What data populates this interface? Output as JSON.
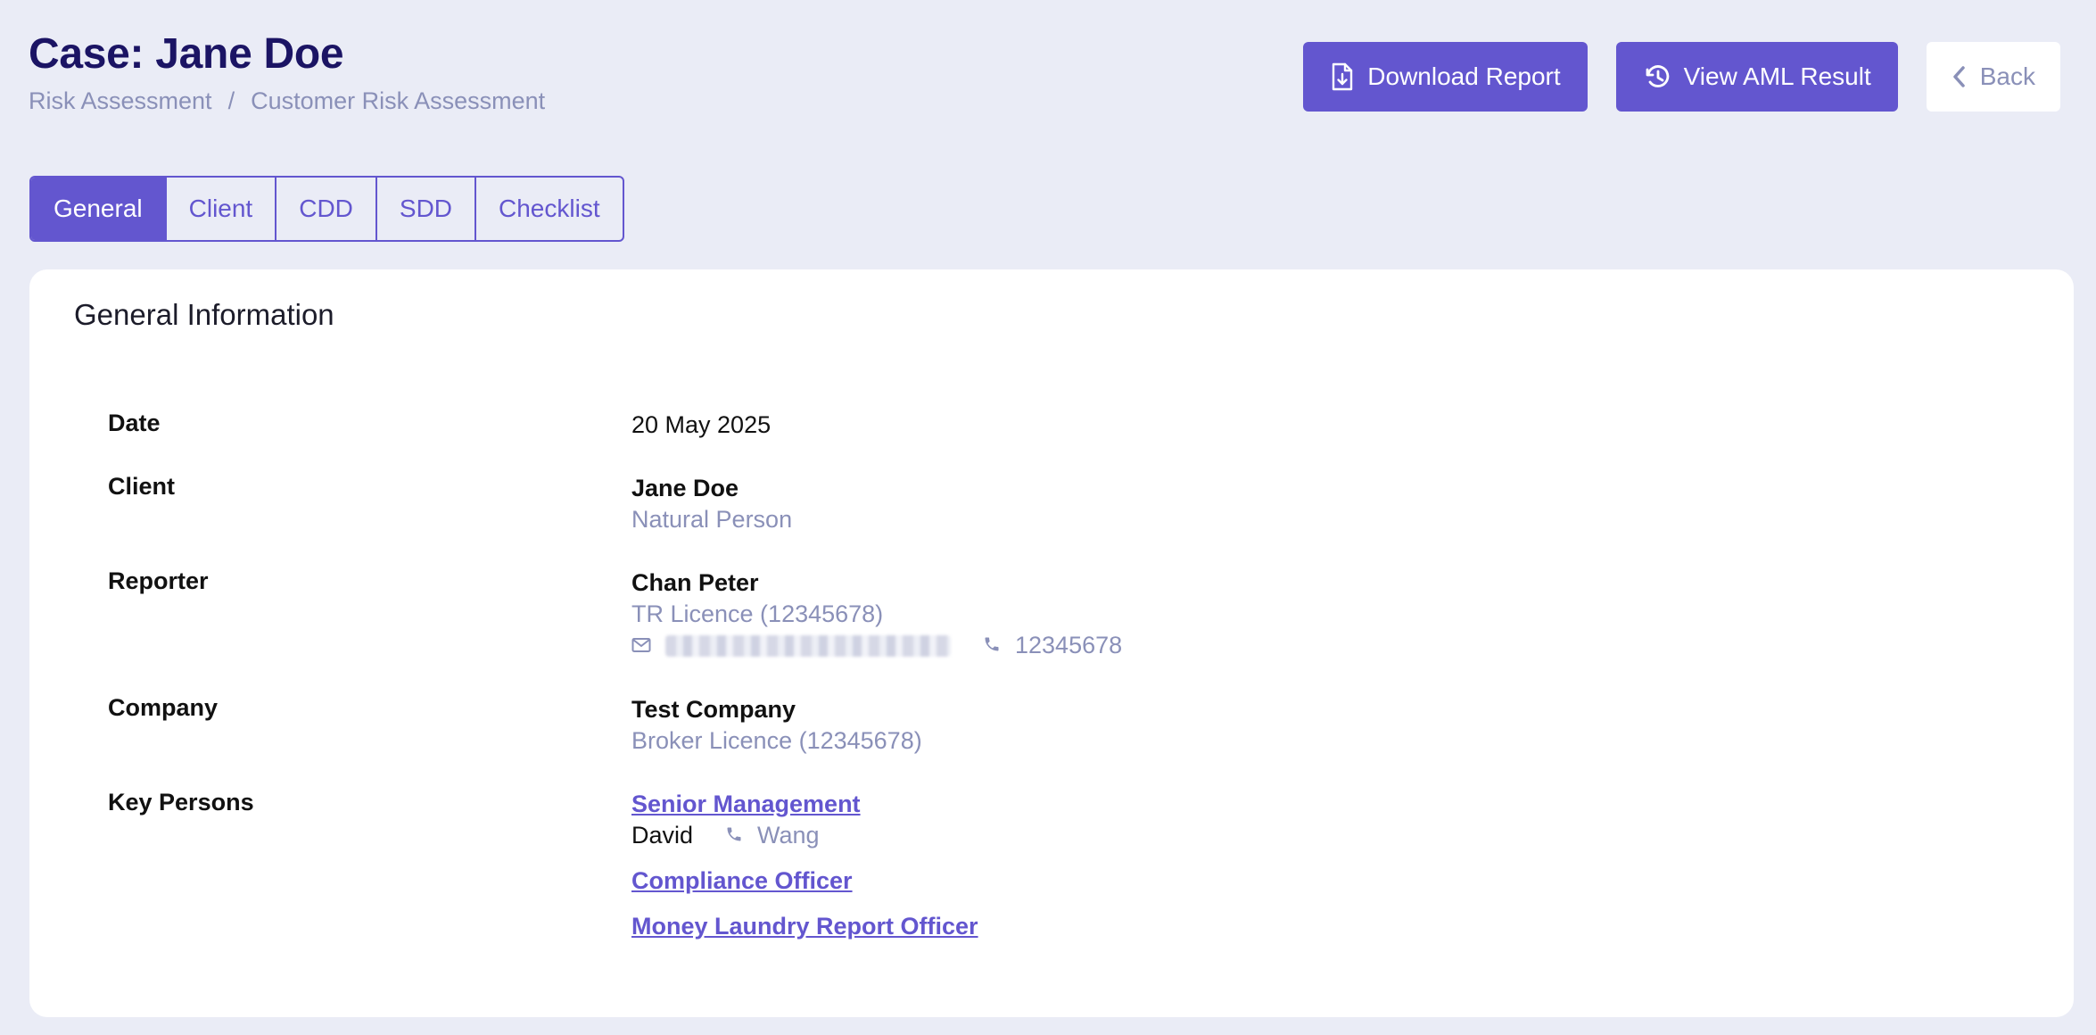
{
  "header": {
    "title": "Case: Jane Doe",
    "breadcrumb": [
      "Risk Assessment",
      "Customer Risk Assessment"
    ],
    "breadcrumb_sep": "/"
  },
  "actions": {
    "download_label": "Download Report",
    "aml_label": "View AML Result",
    "back_label": "Back"
  },
  "tabs": [
    {
      "label": "General",
      "active": true
    },
    {
      "label": "Client",
      "active": false
    },
    {
      "label": "CDD",
      "active": false
    },
    {
      "label": "SDD",
      "active": false
    },
    {
      "label": "Checklist",
      "active": false
    }
  ],
  "card": {
    "title": "General Information",
    "date": {
      "label": "Date",
      "value": "20 May 2025"
    },
    "client": {
      "label": "Client",
      "name": "Jane Doe",
      "type": "Natural Person"
    },
    "reporter": {
      "label": "Reporter",
      "name": "Chan Peter",
      "licence": "TR Licence (12345678)",
      "phone": "12345678"
    },
    "company": {
      "label": "Company",
      "name": "Test Company",
      "licence": "Broker Licence (12345678)"
    },
    "key_persons": {
      "label": "Key Persons",
      "senior_management": "Senior Management",
      "senior_first": "David",
      "senior_last": "Wang",
      "compliance": "Compliance Officer",
      "mlro": "Money Laundry Report Officer"
    }
  },
  "colors": {
    "accent": "#6356cf",
    "title": "#1b1464",
    "muted": "#8a90b8",
    "background": "#eaecf6"
  }
}
